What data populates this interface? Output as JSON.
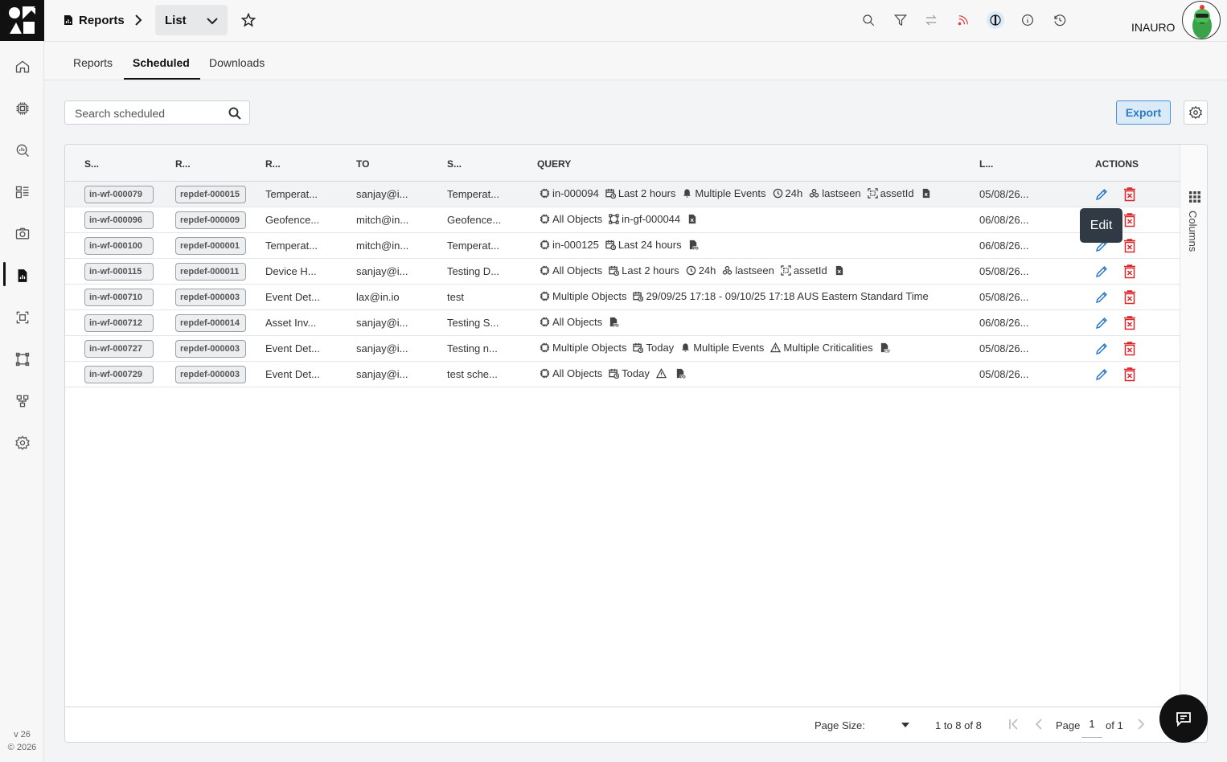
{
  "app": {
    "breadcrumb_title": "Reports",
    "view_select": "List",
    "user_name": "INAURO",
    "version": "v 26",
    "copyright": "© 2026"
  },
  "tabs": [
    "Reports",
    "Scheduled",
    "Downloads"
  ],
  "search": {
    "placeholder": "Search scheduled"
  },
  "toolbar": {
    "export_label": "Export"
  },
  "table": {
    "headers": [
      "S...",
      "R...",
      "R...",
      "TO",
      "S...",
      "QUERY",
      "L...",
      "ACTIONS"
    ],
    "rows": [
      {
        "id": "in-wf-000079",
        "def": "repdef-000015",
        "report": "Temperat...",
        "to": "sanjay@i...",
        "subject": "Temperat...",
        "query": [
          {
            "icon": "chip-icon",
            "text": "in-000094"
          },
          {
            "icon": "calendar-clock-icon",
            "text": "Last 2 hours"
          },
          {
            "icon": "bell-icon",
            "text": "Multiple Events"
          },
          {
            "icon": "clock-icon",
            "text": "24h"
          },
          {
            "icon": "cluster-icon",
            "text": "lastseen"
          },
          {
            "icon": "scan-icon",
            "text": "assetId"
          },
          {
            "icon": "file-xls-icon",
            "text": ""
          }
        ],
        "last": "05/08/26..."
      },
      {
        "id": "in-wf-000096",
        "def": "repdef-000009",
        "report": "Geofence...",
        "to": "mitch@in...",
        "subject": "Geofence...",
        "query": [
          {
            "icon": "chip-icon",
            "text": "All Objects"
          },
          {
            "icon": "geofence-icon",
            "text": "in-gf-000044"
          },
          {
            "icon": "file-xls-icon",
            "text": ""
          }
        ],
        "last": "06/08/26..."
      },
      {
        "id": "in-wf-000100",
        "def": "repdef-000001",
        "report": "Temperat...",
        "to": "mitch@in...",
        "subject": "Temperat...",
        "query": [
          {
            "icon": "chip-icon",
            "text": "in-000125"
          },
          {
            "icon": "calendar-clock-icon",
            "text": "Last 24 hours"
          },
          {
            "icon": "file-pdf-icon",
            "text": ""
          }
        ],
        "last": "06/08/26..."
      },
      {
        "id": "in-wf-000115",
        "def": "repdef-000011",
        "report": "Device H...",
        "to": "sanjay@i...",
        "subject": "Testing D...",
        "query": [
          {
            "icon": "chip-icon",
            "text": "All Objects"
          },
          {
            "icon": "calendar-clock-icon",
            "text": "Last 2 hours"
          },
          {
            "icon": "clock-icon",
            "text": "24h"
          },
          {
            "icon": "cluster-icon",
            "text": "lastseen"
          },
          {
            "icon": "scan-icon",
            "text": "assetId"
          },
          {
            "icon": "file-xls-icon",
            "text": ""
          }
        ],
        "last": "05/08/26..."
      },
      {
        "id": "in-wf-000710",
        "def": "repdef-000003",
        "report": "Event Det...",
        "to": "lax@in.io",
        "subject": "test",
        "query": [
          {
            "icon": "chip-icon",
            "text": "Multiple Objects"
          },
          {
            "icon": "calendar-clock-icon",
            "text": "29/09/25 17:18 - 09/10/25 17:18 AUS Eastern Standard Time"
          }
        ],
        "last": "05/08/26..."
      },
      {
        "id": "in-wf-000712",
        "def": "repdef-000014",
        "report": "Asset Inv...",
        "to": "sanjay@i...",
        "subject": "Testing S...",
        "query": [
          {
            "icon": "chip-icon",
            "text": "All Objects"
          },
          {
            "icon": "file-pdf-icon",
            "text": ""
          }
        ],
        "last": "06/08/26..."
      },
      {
        "id": "in-wf-000727",
        "def": "repdef-000003",
        "report": "Event Det...",
        "to": "sanjay@i...",
        "subject": "Testing n...",
        "query": [
          {
            "icon": "chip-icon",
            "text": "Multiple Objects"
          },
          {
            "icon": "calendar-clock-icon",
            "text": "Today"
          },
          {
            "icon": "bell-icon",
            "text": "Multiple Events"
          },
          {
            "icon": "warning-icon",
            "text": "Multiple Criticalities"
          },
          {
            "icon": "file-csv-icon",
            "text": ""
          }
        ],
        "last": "05/08/26..."
      },
      {
        "id": "in-wf-000729",
        "def": "repdef-000003",
        "report": "Event Det...",
        "to": "sanjay@i...",
        "subject": "test sche...",
        "query": [
          {
            "icon": "chip-icon",
            "text": "All Objects"
          },
          {
            "icon": "calendar-clock-icon",
            "text": "Today"
          },
          {
            "icon": "warning-icon",
            "text": ""
          },
          {
            "icon": "file-pdf-icon",
            "text": ""
          }
        ],
        "last": "05/08/26..."
      }
    ]
  },
  "tooltip": {
    "text": "Edit"
  },
  "columns_panel": {
    "label": "Columns"
  },
  "footer": {
    "page_size_label": "Page Size:",
    "range_text": "1 to 8 of 8",
    "page_label": "Page",
    "page_current": "1",
    "page_of": "of 1"
  },
  "colors": {
    "accent": "#2b7bc8",
    "danger": "#d8262b",
    "dark": "#111111"
  }
}
